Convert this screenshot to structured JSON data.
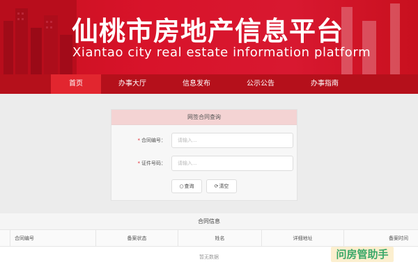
{
  "header": {
    "title": "仙桃市房地产信息平台",
    "subtitle": "Xiantao city real estate information platform"
  },
  "nav": {
    "items": [
      {
        "label": "首页",
        "active": true
      },
      {
        "label": "办事大厅",
        "active": false
      },
      {
        "label": "信息发布",
        "active": false
      },
      {
        "label": "公示公告",
        "active": false
      },
      {
        "label": "办事指南",
        "active": false
      }
    ]
  },
  "query": {
    "title": "网签合同查询",
    "contract_label": "合同编号：",
    "contract_placeholder": "请输入...",
    "id_label": "证件号码：",
    "id_placeholder": "请输入...",
    "required_mark": "*",
    "search_label": "查询",
    "clear_label": "清空"
  },
  "results": {
    "title": "合同信息",
    "columns": [
      "合同编号",
      "备案状态",
      "姓名",
      "详细地址",
      "备案时间"
    ],
    "empty_text": "暂无数据"
  },
  "watermark": "问房管助手",
  "colors": {
    "brand_red": "#d8132a",
    "nav_red": "#b5101b",
    "nav_active": "#e2262f"
  }
}
